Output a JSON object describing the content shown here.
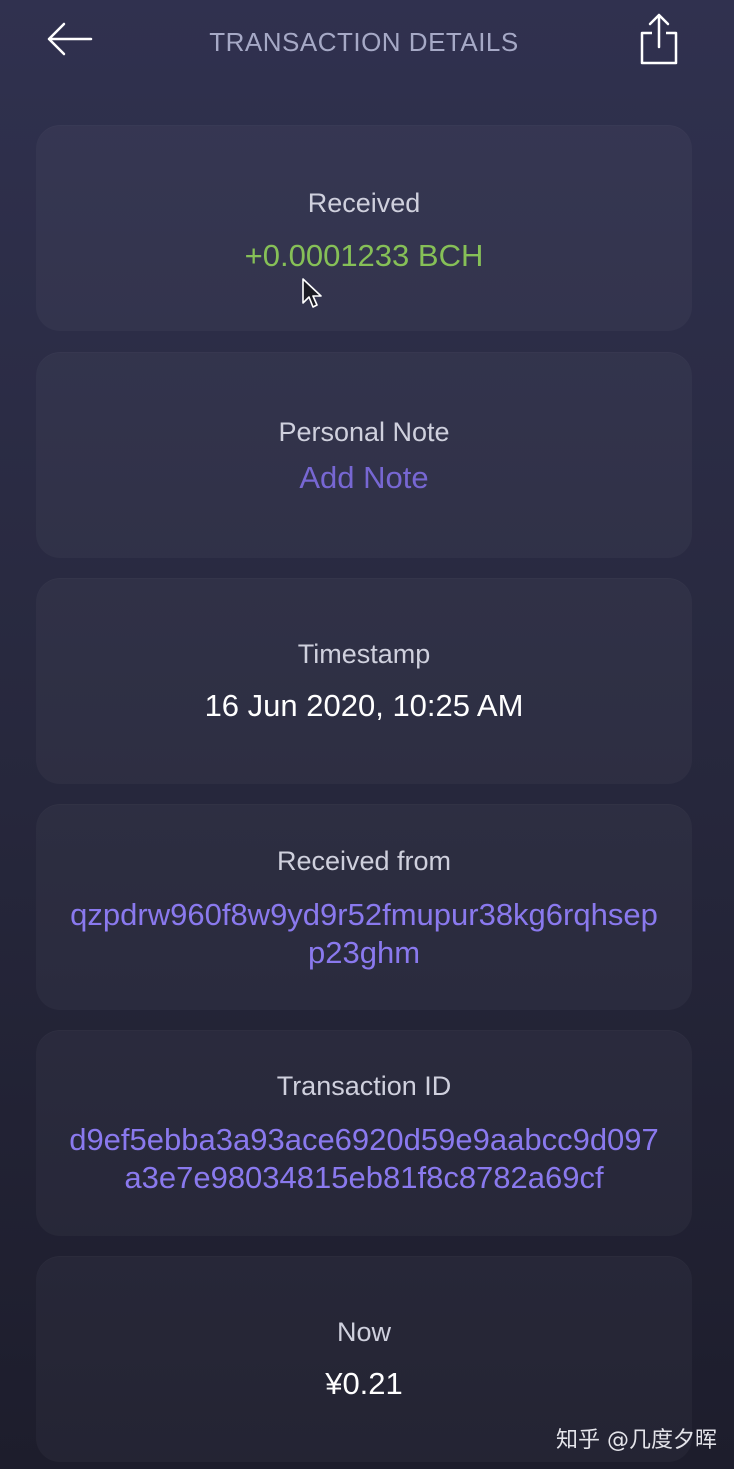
{
  "header": {
    "title": "TRANSACTION DETAILS",
    "back_icon": "arrow-left-icon",
    "share_icon": "share-icon"
  },
  "cards": {
    "received": {
      "label": "Received",
      "value": "+0.0001233 BCH"
    },
    "note": {
      "label": "Personal Note",
      "value": "Add Note"
    },
    "timestamp": {
      "label": "Timestamp",
      "value": "16 Jun 2020, 10:25 AM"
    },
    "received_from": {
      "label": "Received from",
      "value": "qzpdrw960f8w9yd9r52fmupur38kg6rqhsepp23ghm"
    },
    "transaction_id": {
      "label": "Transaction ID",
      "value": "d9ef5ebba3a93ace6920d59e9aabcc9d097a3e7e98034815eb81f8c8782a69cf"
    },
    "now": {
      "label": "Now",
      "value": "¥0.21"
    }
  },
  "watermark": "知乎 @几度夕晖",
  "colors": {
    "positive": "#86c057",
    "accent": "#7767d3",
    "link": "#8a79ee",
    "title": "#a6a9c6"
  }
}
